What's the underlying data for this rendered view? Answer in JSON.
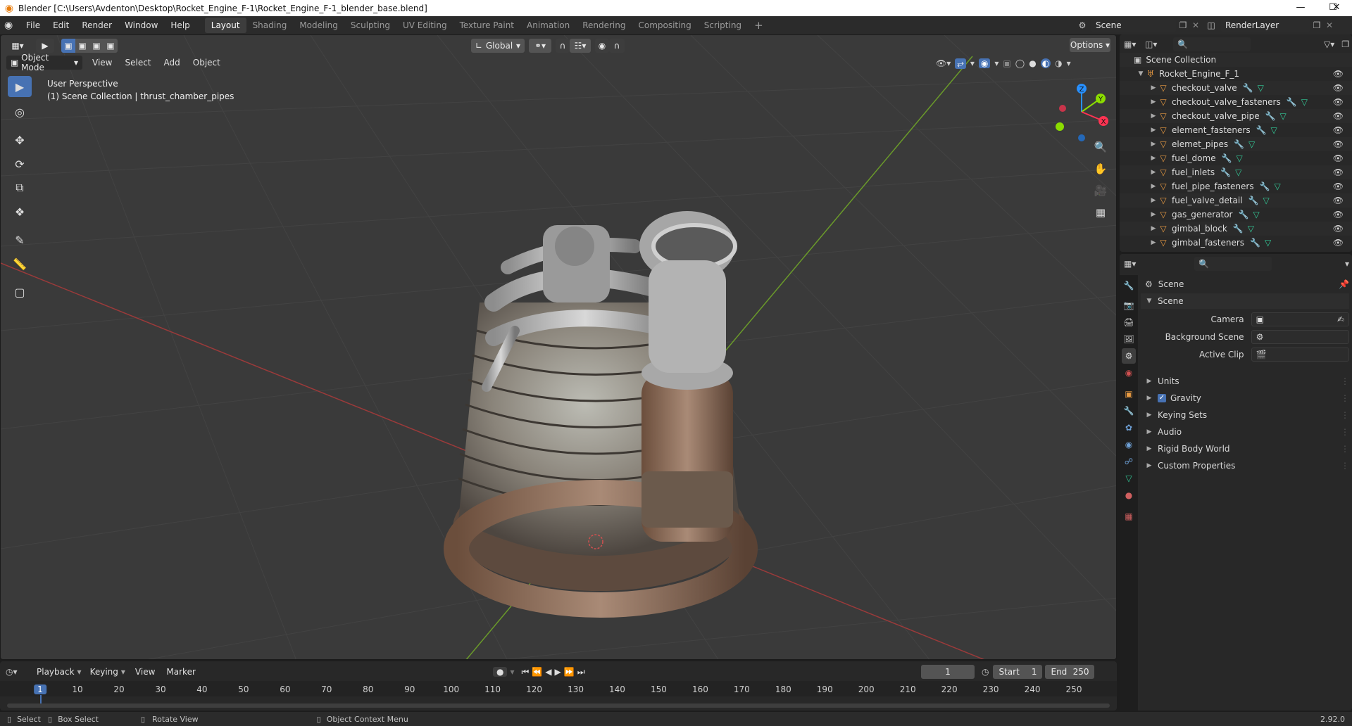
{
  "window": {
    "title": "Blender [C:\\Users\\Avdenton\\Desktop\\Rocket_Engine_F-1\\Rocket_Engine_F-1_blender_base.blend]",
    "minimize": "—",
    "maximize": "☐",
    "close": "✕"
  },
  "menu": [
    "File",
    "Edit",
    "Render",
    "Window",
    "Help"
  ],
  "workspaces": [
    {
      "label": "Layout",
      "active": true
    },
    {
      "label": "Shading"
    },
    {
      "label": "Modeling"
    },
    {
      "label": "Sculpting"
    },
    {
      "label": "UV Editing"
    },
    {
      "label": "Texture Paint"
    },
    {
      "label": "Animation"
    },
    {
      "label": "Rendering"
    },
    {
      "label": "Compositing"
    },
    {
      "label": "Scripting"
    }
  ],
  "add_workspace": "+",
  "scene_selector": "Scene",
  "view_layer": "RenderLayer",
  "viewport": {
    "transform_orientation": "Global",
    "options": "Options",
    "mode": "Object Mode",
    "header_menus": [
      "View",
      "Select",
      "Add",
      "Object"
    ],
    "overlay_line1": "User Perspective",
    "overlay_line2": "(1) Scene Collection | thrust_chamber_pipes",
    "gizmo": {
      "x": "X",
      "y": "Y",
      "z": "Z"
    }
  },
  "outliner": {
    "root": "Scene Collection",
    "collection": "Rocket_Engine_F_1",
    "objects": [
      "checkout_valve",
      "checkout_valve_fasteners",
      "checkout_valve_pipe",
      "element_fasteners",
      "elemet_pipes",
      "fuel_dome",
      "fuel_inlets",
      "fuel_pipe_fasteners",
      "fuel_valve_detail",
      "gas_generator",
      "gimbal_block",
      "gimbal_fasteners"
    ]
  },
  "properties": {
    "context": "Scene",
    "panel": "Scene",
    "fields": [
      {
        "label": "Camera",
        "value": ""
      },
      {
        "label": "Background Scene",
        "value": ""
      },
      {
        "label": "Active Clip",
        "value": ""
      }
    ],
    "subpanels": [
      {
        "label": "Units",
        "checkbox": false
      },
      {
        "label": "Gravity",
        "checkbox": true
      },
      {
        "label": "Keying Sets",
        "checkbox": false
      },
      {
        "label": "Audio",
        "checkbox": false
      },
      {
        "label": "Rigid Body World",
        "checkbox": false
      },
      {
        "label": "Custom Properties",
        "checkbox": false
      }
    ]
  },
  "timeline": {
    "menus": [
      "Playback",
      "Keying",
      "View",
      "Marker"
    ],
    "current_frame": "1",
    "start_label": "Start",
    "start": "1",
    "end_label": "End",
    "end": "250",
    "ruler": [
      "1",
      "10",
      "20",
      "30",
      "40",
      "50",
      "60",
      "70",
      "80",
      "90",
      "100",
      "110",
      "120",
      "130",
      "140",
      "150",
      "160",
      "170",
      "180",
      "190",
      "200",
      "210",
      "220",
      "230",
      "240",
      "250"
    ]
  },
  "status": {
    "select": "Select",
    "box_select": "Box Select",
    "rotate": "Rotate View",
    "context_menu": "Object Context Menu",
    "version": "2.92.0"
  },
  "colors": {
    "accent": "#4772b3",
    "x_axis": "#ff3352",
    "y_axis": "#8bdc00",
    "z_axis": "#2890ff",
    "object_orange": "#e89a42"
  }
}
